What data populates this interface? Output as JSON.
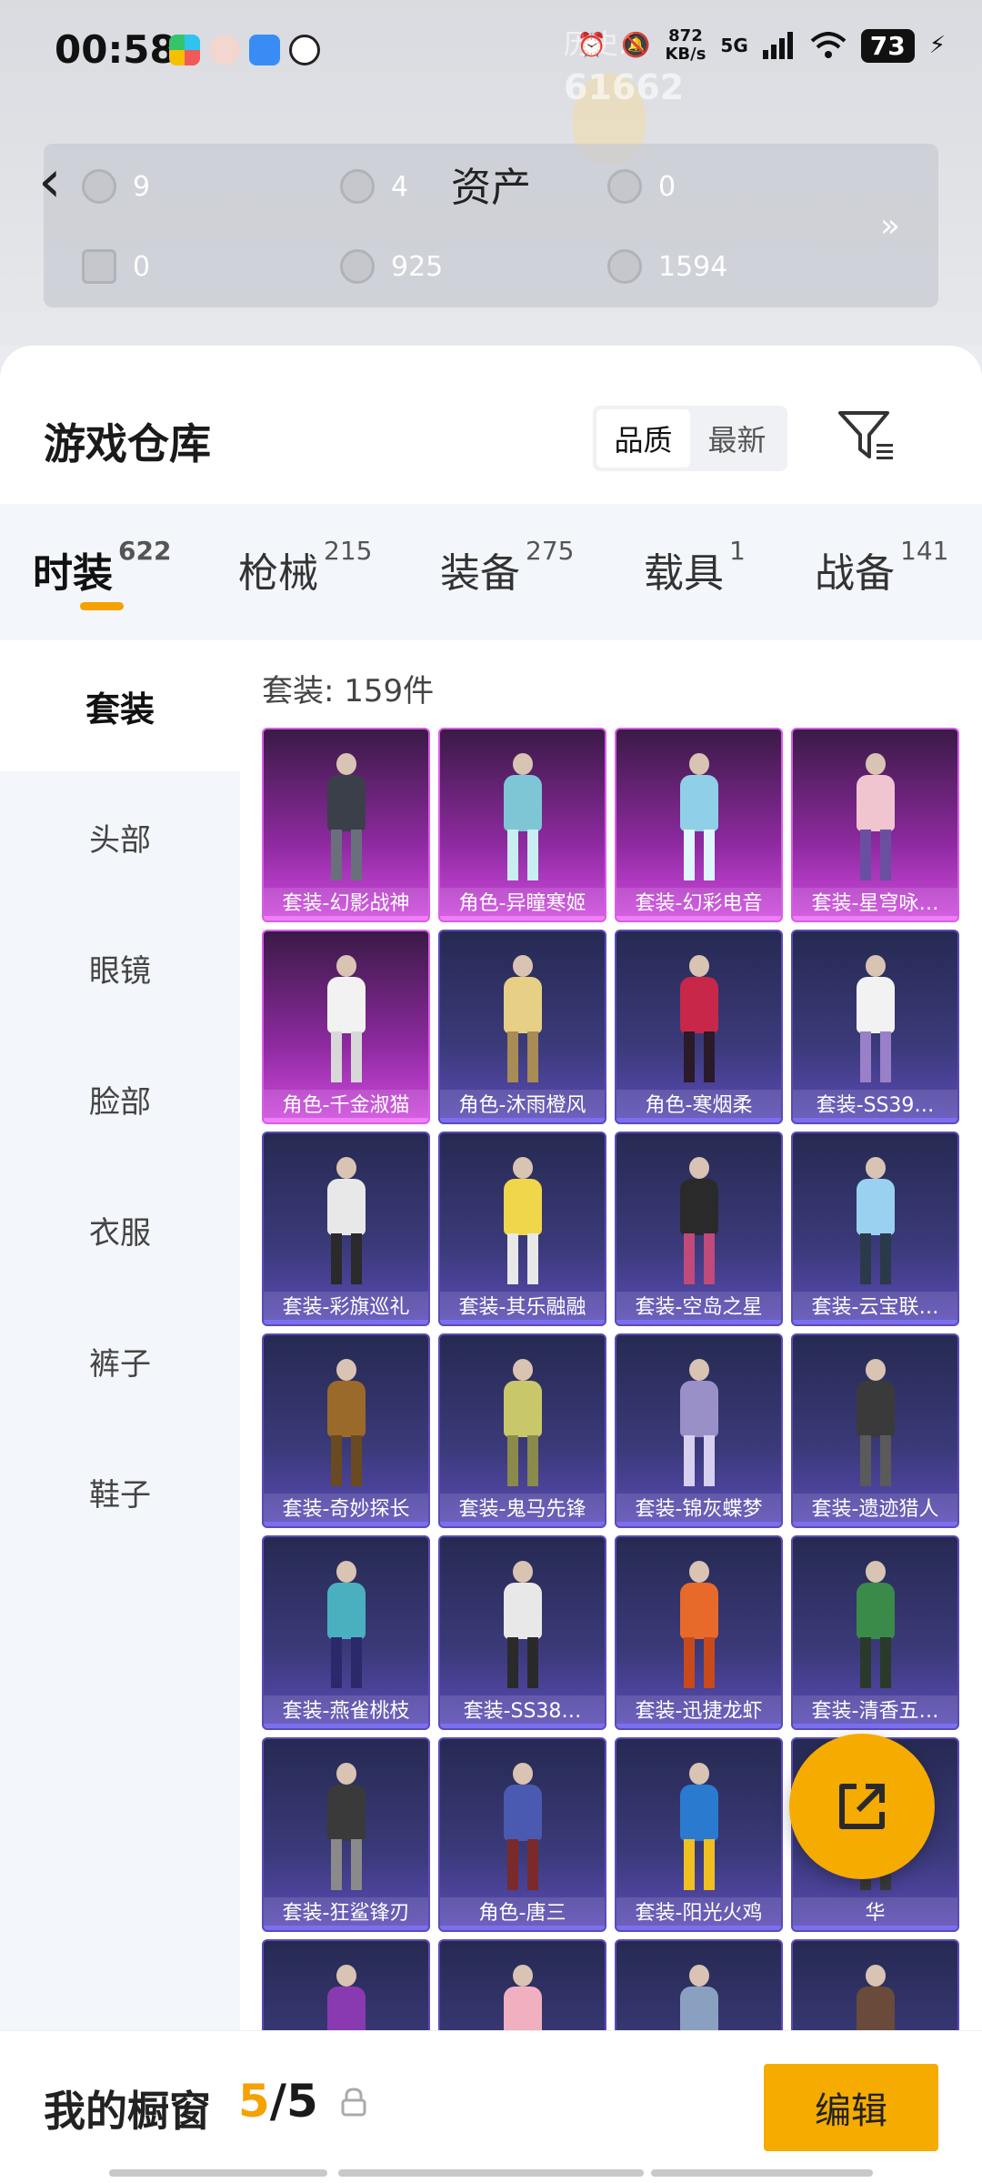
{
  "status_bar": {
    "time": "00:58",
    "net_speed_value": "872",
    "net_speed_unit": "KB/s",
    "network": "5G",
    "battery": "73"
  },
  "header": {
    "ghost_text": "历史...",
    "ghost_score": "61662",
    "assets": {
      "title": "资产",
      "items": [
        {
          "value": "9"
        },
        {
          "value": "4"
        },
        {
          "value": "0"
        },
        {
          "value": "0"
        },
        {
          "value": "925"
        },
        {
          "value": "1594"
        }
      ]
    }
  },
  "warehouse": {
    "title": "游戏仓库",
    "sort_options": [
      "品质",
      "最新"
    ],
    "active_sort": "品质"
  },
  "categories": [
    {
      "label": "时装",
      "count": "622"
    },
    {
      "label": "枪械",
      "count": "215"
    },
    {
      "label": "装备",
      "count": "275"
    },
    {
      "label": "载具",
      "count": "1"
    },
    {
      "label": "战备",
      "count": "141"
    }
  ],
  "sidebar": {
    "items": [
      "套装",
      "头部",
      "眼镜",
      "脸部",
      "衣服",
      "裤子",
      "鞋子"
    ]
  },
  "grid": {
    "count_label": "套装: 159件",
    "items": [
      {
        "label": "套装-幻影战神",
        "rarity": "legendary"
      },
      {
        "label": "角色-异瞳寒姬",
        "rarity": "legendary"
      },
      {
        "label": "套装-幻彩电音",
        "rarity": "legendary"
      },
      {
        "label": "套装-星穹咏…",
        "rarity": "legendary"
      },
      {
        "label": "角色-千金淑猫",
        "rarity": "legendary"
      },
      {
        "label": "角色-沐雨橙风",
        "rarity": "epic"
      },
      {
        "label": "角色-寒烟柔",
        "rarity": "epic"
      },
      {
        "label": "套装-SS39…",
        "rarity": "epic"
      },
      {
        "label": "套装-彩旗巡礼",
        "rarity": "epic"
      },
      {
        "label": "套装-其乐融融",
        "rarity": "epic"
      },
      {
        "label": "套装-空岛之星",
        "rarity": "epic"
      },
      {
        "label": "套装-云宝联…",
        "rarity": "epic"
      },
      {
        "label": "套装-奇妙探长",
        "rarity": "epic"
      },
      {
        "label": "套装-鬼马先锋",
        "rarity": "epic"
      },
      {
        "label": "套装-锦灰蝶梦",
        "rarity": "epic"
      },
      {
        "label": "套装-遗迹猎人",
        "rarity": "epic"
      },
      {
        "label": "套装-燕雀桃枝",
        "rarity": "epic"
      },
      {
        "label": "套装-SS38…",
        "rarity": "epic"
      },
      {
        "label": "套装-迅捷龙虾",
        "rarity": "epic"
      },
      {
        "label": "套装-清香五…",
        "rarity": "epic"
      },
      {
        "label": "套装-狂鲨锋刃",
        "rarity": "epic"
      },
      {
        "label": "角色-唐三",
        "rarity": "epic"
      },
      {
        "label": "套装-阳光火鸡",
        "rarity": "epic"
      },
      {
        "label": "华",
        "rarity": "epic"
      },
      {
        "label": "",
        "rarity": "epic"
      },
      {
        "label": "",
        "rarity": "epic"
      },
      {
        "label": "",
        "rarity": "epic"
      },
      {
        "label": "",
        "rarity": "epic"
      }
    ]
  },
  "showcase": {
    "label": "我的橱窗",
    "current": "5",
    "total": "/5",
    "edit_label": "编辑"
  },
  "colors": {
    "accent": "#f5ab00",
    "legendary_tile": "#c03fd2",
    "epic_tile": "#4a3f9e"
  }
}
